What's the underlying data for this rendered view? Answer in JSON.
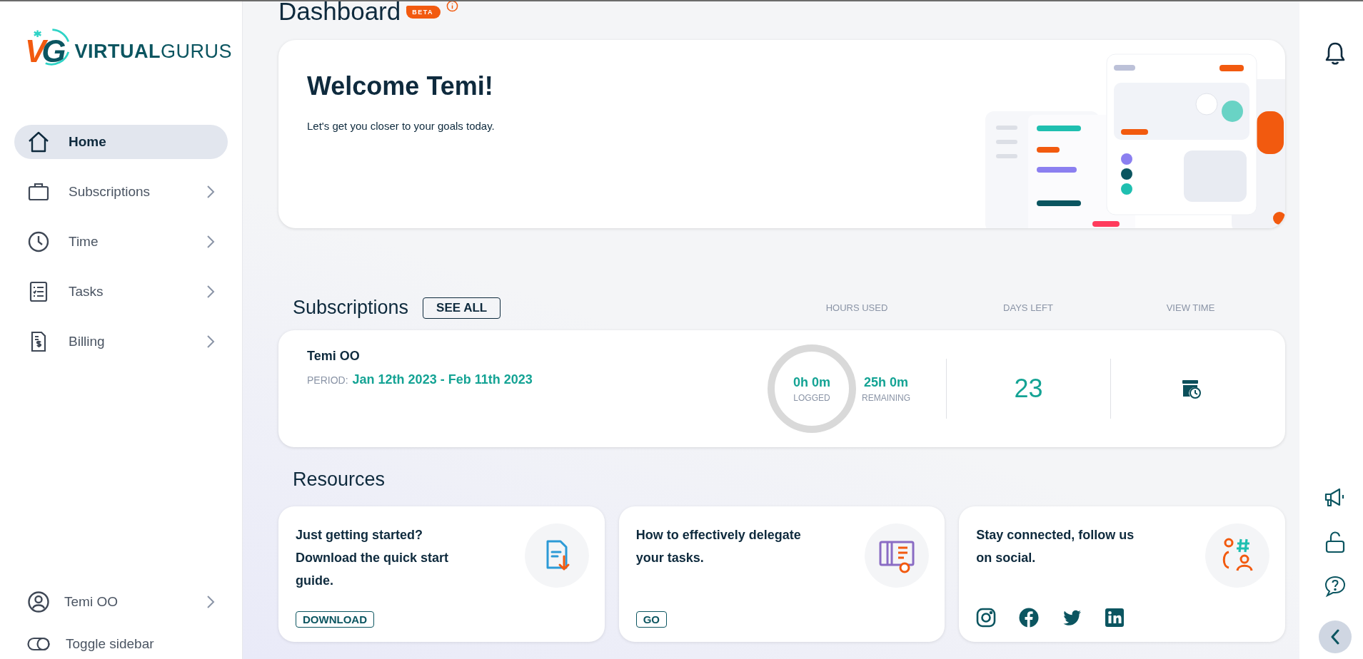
{
  "logo": {
    "mark": "VG",
    "name": "**VIRTUAL**GURUS"
  },
  "sidebar": {
    "items": [
      {
        "label": "Home",
        "selected": true,
        "expandable": false
      },
      {
        "label": "Subscriptions",
        "selected": false,
        "expandable": true
      },
      {
        "label": "Time",
        "selected": false,
        "expandable": true
      },
      {
        "label": "Tasks",
        "selected": false,
        "expandable": true
      },
      {
        "label": "Billing",
        "selected": false,
        "expandable": true
      }
    ],
    "user": {
      "label": "Temi OO"
    },
    "toggle": {
      "label": "Toggle sidebar"
    }
  },
  "page": {
    "title": "Dashboard",
    "badge": "BETA"
  },
  "welcome": {
    "title": "Welcome Temi!",
    "subtitle": "Let's get you closer to your goals today."
  },
  "subscriptions": {
    "title": "Subscriptions",
    "see_all": "SEE ALL",
    "columns": [
      "HOURS USED",
      "DAYS LEFT",
      "VIEW TIME"
    ],
    "rows": [
      {
        "name": "Temi OO",
        "period_label": "PERIOD:",
        "period": "Jan 12th 2023 - Feb 11th 2023",
        "logged": "0h 0m",
        "logged_label": "LOGGED",
        "remaining": "25h 0m",
        "remaining_label": "REMAINING",
        "days_left": "23"
      }
    ]
  },
  "resources": {
    "title": "Resources",
    "cards": [
      {
        "kind": "button",
        "text": "Just getting started? Download the quick start guide.",
        "button": "DOWNLOAD"
      },
      {
        "kind": "button",
        "text": "How to effectively delegate your tasks.",
        "button": "GO"
      },
      {
        "kind": "social",
        "text": "Stay connected, follow us on social."
      }
    ]
  }
}
